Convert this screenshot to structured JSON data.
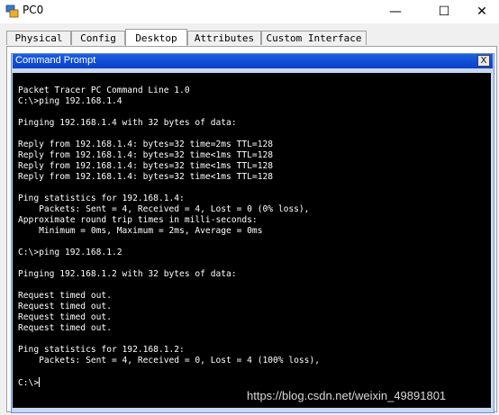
{
  "window": {
    "title": "PC0",
    "controls": {
      "minimize": "—",
      "maximize": "☐",
      "close": "✕"
    }
  },
  "tabs": [
    {
      "label": "Physical",
      "active": false
    },
    {
      "label": "Config",
      "active": false
    },
    {
      "label": "Desktop",
      "active": true
    },
    {
      "label": "Attributes",
      "active": false
    },
    {
      "label": "Custom Interface",
      "active": false
    }
  ],
  "command_prompt": {
    "title": "Command Prompt",
    "close_label": "X",
    "output": "Packet Tracer PC Command Line 1.0\nC:\\>ping 192.168.1.4\n\nPinging 192.168.1.4 with 32 bytes of data:\n\nReply from 192.168.1.4: bytes=32 time=2ms TTL=128\nReply from 192.168.1.4: bytes=32 time<1ms TTL=128\nReply from 192.168.1.4: bytes=32 time<1ms TTL=128\nReply from 192.168.1.4: bytes=32 time<1ms TTL=128\n\nPing statistics for 192.168.1.4:\n    Packets: Sent = 4, Received = 4, Lost = 0 (0% loss),\nApproximate round trip times in milli-seconds:\n    Minimum = 0ms, Maximum = 2ms, Average = 0ms\n\nC:\\>ping 192.168.1.2\n\nPinging 192.168.1.2 with 32 bytes of data:\n\nRequest timed out.\nRequest timed out.\nRequest timed out.\nRequest timed out.\n\nPing statistics for 192.168.1.2:\n    Packets: Sent = 4, Received = 0, Lost = 4 (100% loss),\n\n",
    "prompt": "C:\\>"
  },
  "watermark": "https://blog.csdn.net/weixin_49891801",
  "colors": {
    "terminal_bg": "#000000",
    "terminal_fg": "#ffffff",
    "titlebar_blue": "#0a3fc8"
  }
}
